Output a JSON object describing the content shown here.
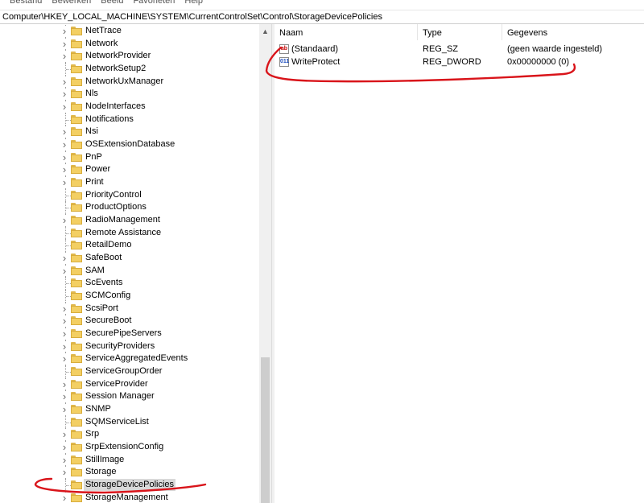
{
  "menu": [
    "Bestand",
    "Bewerken",
    "Beeld",
    "Favorieten",
    "Help"
  ],
  "address": "Computer\\HKEY_LOCAL_MACHINE\\SYSTEM\\CurrentControlSet\\Control\\StorageDevicePolicies",
  "tree": {
    "items": [
      {
        "label": "NetTrace",
        "expandable": true
      },
      {
        "label": "Network",
        "expandable": true
      },
      {
        "label": "NetworkProvider",
        "expandable": true
      },
      {
        "label": "NetworkSetup2",
        "expandable": false
      },
      {
        "label": "NetworkUxManager",
        "expandable": true
      },
      {
        "label": "Nls",
        "expandable": true
      },
      {
        "label": "NodeInterfaces",
        "expandable": true
      },
      {
        "label": "Notifications",
        "expandable": false
      },
      {
        "label": "Nsi",
        "expandable": true
      },
      {
        "label": "OSExtensionDatabase",
        "expandable": true
      },
      {
        "label": "PnP",
        "expandable": true
      },
      {
        "label": "Power",
        "expandable": true
      },
      {
        "label": "Print",
        "expandable": true
      },
      {
        "label": "PriorityControl",
        "expandable": false
      },
      {
        "label": "ProductOptions",
        "expandable": false
      },
      {
        "label": "RadioManagement",
        "expandable": true
      },
      {
        "label": "Remote Assistance",
        "expandable": false
      },
      {
        "label": "RetailDemo",
        "expandable": false
      },
      {
        "label": "SafeBoot",
        "expandable": true
      },
      {
        "label": "SAM",
        "expandable": true
      },
      {
        "label": "ScEvents",
        "expandable": false
      },
      {
        "label": "SCMConfig",
        "expandable": false
      },
      {
        "label": "ScsiPort",
        "expandable": true
      },
      {
        "label": "SecureBoot",
        "expandable": true
      },
      {
        "label": "SecurePipeServers",
        "expandable": true
      },
      {
        "label": "SecurityProviders",
        "expandable": true
      },
      {
        "label": "ServiceAggregatedEvents",
        "expandable": true
      },
      {
        "label": "ServiceGroupOrder",
        "expandable": false
      },
      {
        "label": "ServiceProvider",
        "expandable": true
      },
      {
        "label": "Session Manager",
        "expandable": true
      },
      {
        "label": "SNMP",
        "expandable": true
      },
      {
        "label": "SQMServiceList",
        "expandable": false
      },
      {
        "label": "Srp",
        "expandable": true
      },
      {
        "label": "SrpExtensionConfig",
        "expandable": true
      },
      {
        "label": "StillImage",
        "expandable": true
      },
      {
        "label": "Storage",
        "expandable": true
      },
      {
        "label": "StorageDevicePolicies",
        "expandable": false,
        "selected": true
      },
      {
        "label": "StorageManagement",
        "expandable": true
      }
    ]
  },
  "list": {
    "columns": [
      "Naam",
      "Type",
      "Gegevens"
    ],
    "rows": [
      {
        "icon": "ab",
        "icon_name": "string-value-icon",
        "name": "(Standaard)",
        "type": "REG_SZ",
        "data": "(geen waarde ingesteld)"
      },
      {
        "icon": "011",
        "icon_name": "binary-value-icon",
        "name": "WriteProtect",
        "type": "REG_DWORD",
        "data": "0x00000000 (0)"
      }
    ]
  },
  "colors": {
    "annotation": "#d9141a",
    "selection": "#d9d9d9",
    "folder": "#f3cf63"
  }
}
